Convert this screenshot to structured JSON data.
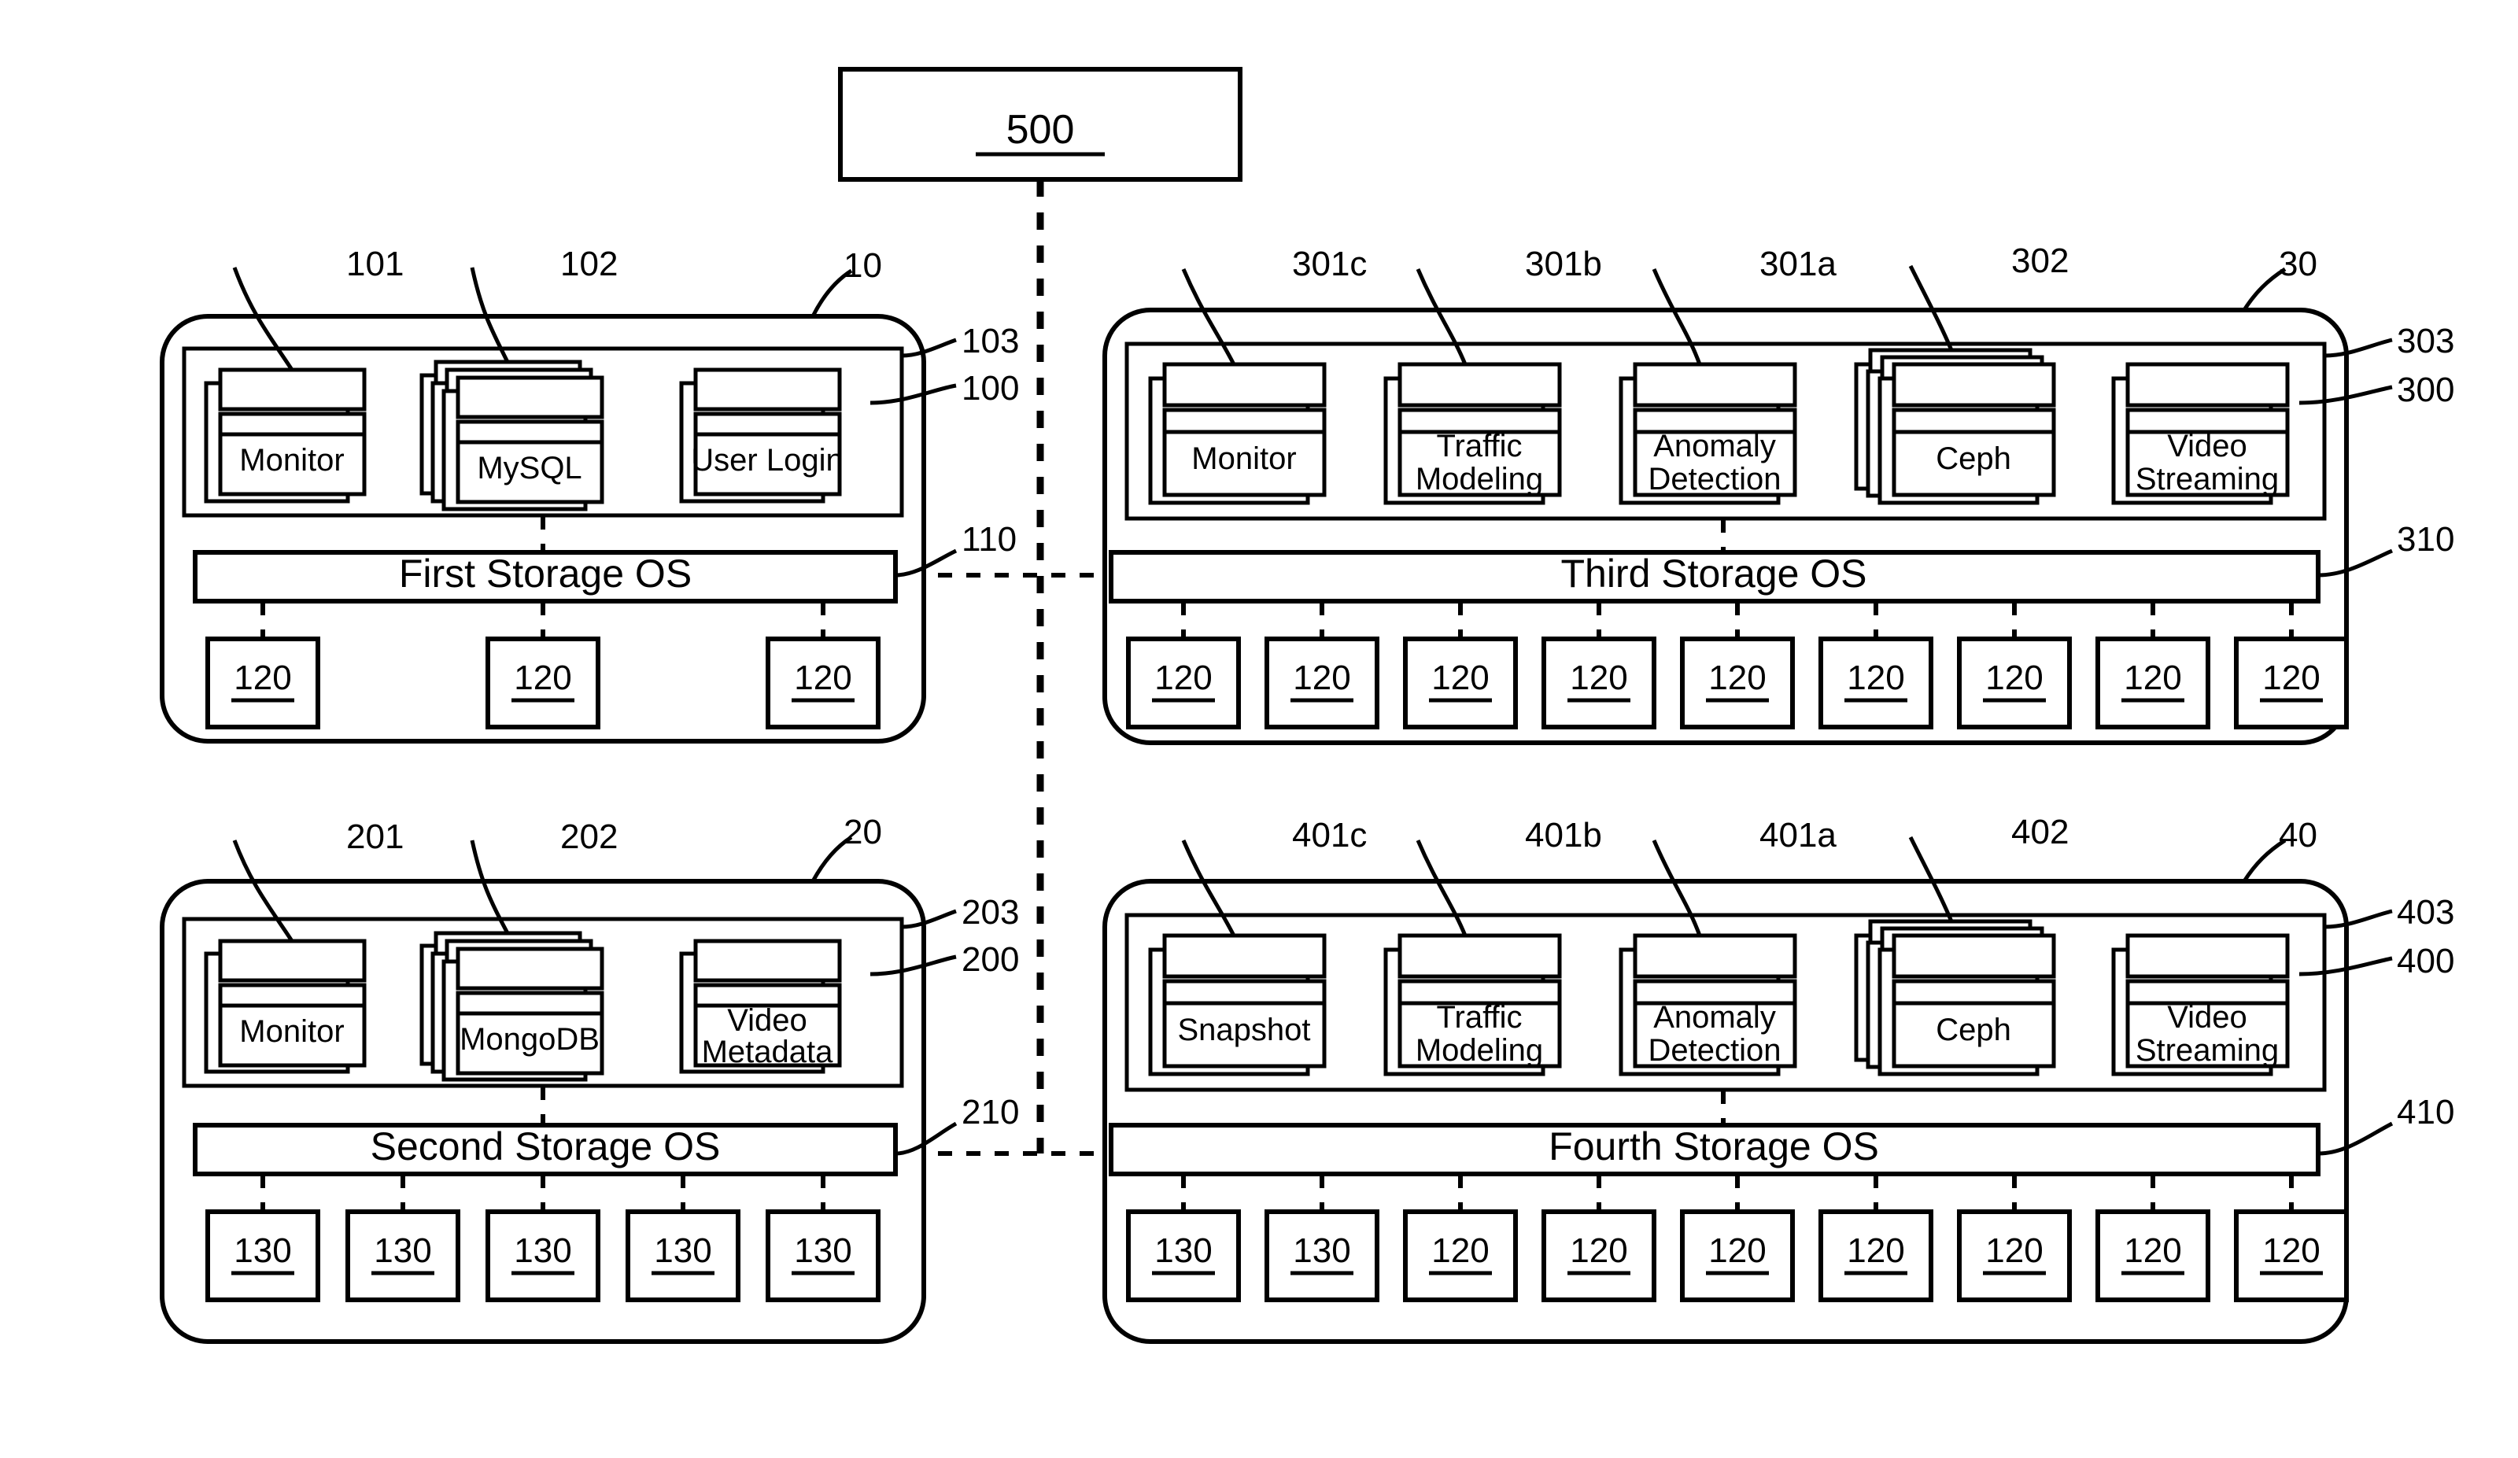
{
  "diagram": {
    "title_box": {
      "label": "500"
    },
    "nodes": [
      {
        "id": "node-10",
        "ref_node": "10",
        "ref_inner_outer": "103",
        "ref_inner": "100",
        "ref_os": "110",
        "os_label": "First Storage OS",
        "containers": [
          {
            "label": "Monitor",
            "ref": "101",
            "stack": 1
          },
          {
            "label": "MySQL",
            "ref": "102",
            "stack": 3
          },
          {
            "label": "User Login",
            "ref": "",
            "stack": 1
          }
        ],
        "disks": [
          "120",
          "120",
          "120"
        ]
      },
      {
        "id": "node-30",
        "ref_node": "30",
        "ref_inner_outer": "303",
        "ref_inner": "300",
        "ref_os": "310",
        "os_label": "Third Storage OS",
        "containers": [
          {
            "label": "Monitor",
            "ref": "301c",
            "stack": 1
          },
          {
            "label": "Traffic Modeling",
            "ref": "301b",
            "stack": 1
          },
          {
            "label": "Anomaly Detection",
            "ref": "301a",
            "stack": 1
          },
          {
            "label": "Ceph",
            "ref": "302",
            "stack": 3
          },
          {
            "label": "Video Streaming",
            "ref": "",
            "stack": 1
          }
        ],
        "disks": [
          "120",
          "120",
          "120",
          "120",
          "120",
          "120",
          "120",
          "120",
          "120"
        ]
      },
      {
        "id": "node-20",
        "ref_node": "20",
        "ref_inner_outer": "203",
        "ref_inner": "200",
        "ref_os": "210",
        "os_label": "Second Storage OS",
        "containers": [
          {
            "label": "Monitor",
            "ref": "201",
            "stack": 1
          },
          {
            "label": "MongoDB",
            "ref": "202",
            "stack": 3
          },
          {
            "label": "Video Metadata",
            "ref": "",
            "stack": 1
          }
        ],
        "disks": [
          "130",
          "130",
          "130",
          "130",
          "130"
        ]
      },
      {
        "id": "node-40",
        "ref_node": "40",
        "ref_inner_outer": "403",
        "ref_inner": "400",
        "ref_os": "410",
        "os_label": "Fourth Storage OS",
        "containers": [
          {
            "label": "Snapshot",
            "ref": "401c",
            "stack": 1
          },
          {
            "label": "Traffic Modeling",
            "ref": "401b",
            "stack": 1
          },
          {
            "label": "Anomaly Detection",
            "ref": "401a",
            "stack": 1
          },
          {
            "label": "Ceph",
            "ref": "402",
            "stack": 3
          },
          {
            "label": "Video Streaming",
            "ref": "",
            "stack": 1
          }
        ],
        "disks": [
          "130",
          "130",
          "120",
          "120",
          "120",
          "120",
          "120",
          "120",
          "120"
        ]
      }
    ],
    "colors": {
      "ink": "#000000",
      "paper": "#ffffff"
    }
  }
}
